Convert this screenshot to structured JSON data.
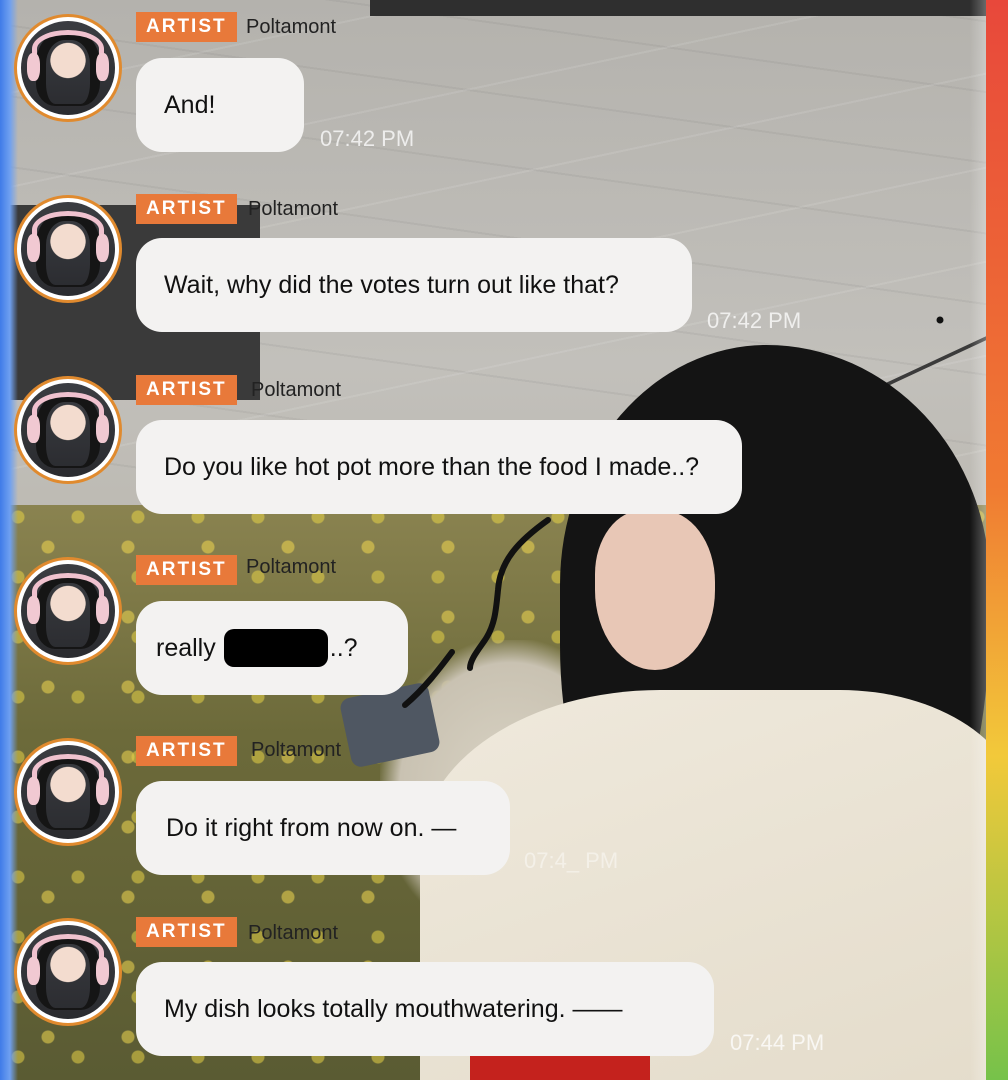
{
  "badge_label": "ARTIST",
  "sender_name": "Poltamont",
  "messages": [
    {
      "text": "And!",
      "time": "07:42 PM"
    },
    {
      "text": "Wait, why did the votes turn out like that?",
      "time": "07:42 PM"
    },
    {
      "text": "Do you like hot pot more than the food I made..?",
      "time": ""
    },
    {
      "text_before": "really",
      "text_after": "..?",
      "time": ""
    },
    {
      "text": "Do it right from now on. —",
      "time": "07:4_ PM"
    },
    {
      "text": "My dish looks totally mouthwatering. ——",
      "time": "07:44 PM"
    }
  ],
  "colors": {
    "badge": "#e8793a",
    "avatar_ring": "#e08a2e",
    "bubble": "#f3f2f1"
  },
  "icons": [
    "avatar-portrait",
    "redaction-block"
  ]
}
